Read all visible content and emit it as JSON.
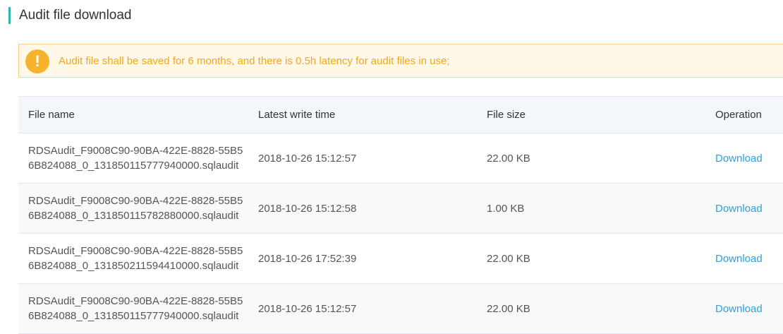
{
  "page": {
    "title": "Audit file download"
  },
  "notice": {
    "icon": "warning-icon",
    "glyph": "!",
    "text": "Audit file shall be saved for 6 months, and there is 0.5h latency for audit files in use;",
    "color": "#f3a81b"
  },
  "table": {
    "headers": {
      "file_name": "File name",
      "latest_write_time": "Latest write time",
      "file_size": "File size",
      "operation": "Operation"
    },
    "rows": [
      {
        "file_name": "RDSAudit_F9008C90-90BA-422E-8828-55B56B824088_0_131850115777940000.sqlaudit",
        "latest_write_time": "2018-10-26 15:12:57",
        "file_size": "22.00 KB",
        "operation": "Download"
      },
      {
        "file_name": "RDSAudit_F9008C90-90BA-422E-8828-55B56B824088_0_131850115782880000.sqlaudit",
        "latest_write_time": "2018-10-26 15:12:58",
        "file_size": "1.00 KB",
        "operation": "Download"
      },
      {
        "file_name": "RDSAudit_F9008C90-90BA-422E-8828-55B56B824088_0_131850211594410000.sqlaudit",
        "latest_write_time": "2018-10-26 17:52:39",
        "file_size": "22.00 KB",
        "operation": "Download"
      },
      {
        "file_name": "RDSAudit_F9008C90-90BA-422E-8828-55B56B824088_0_131850115777940000.sqlaudit",
        "latest_write_time": "2018-10-26 15:12:57",
        "file_size": "22.00 KB",
        "operation": "Download"
      }
    ]
  },
  "colors": {
    "accent": "#34b6a4",
    "link": "#2ea0dc",
    "warning": "#f7b32b"
  }
}
